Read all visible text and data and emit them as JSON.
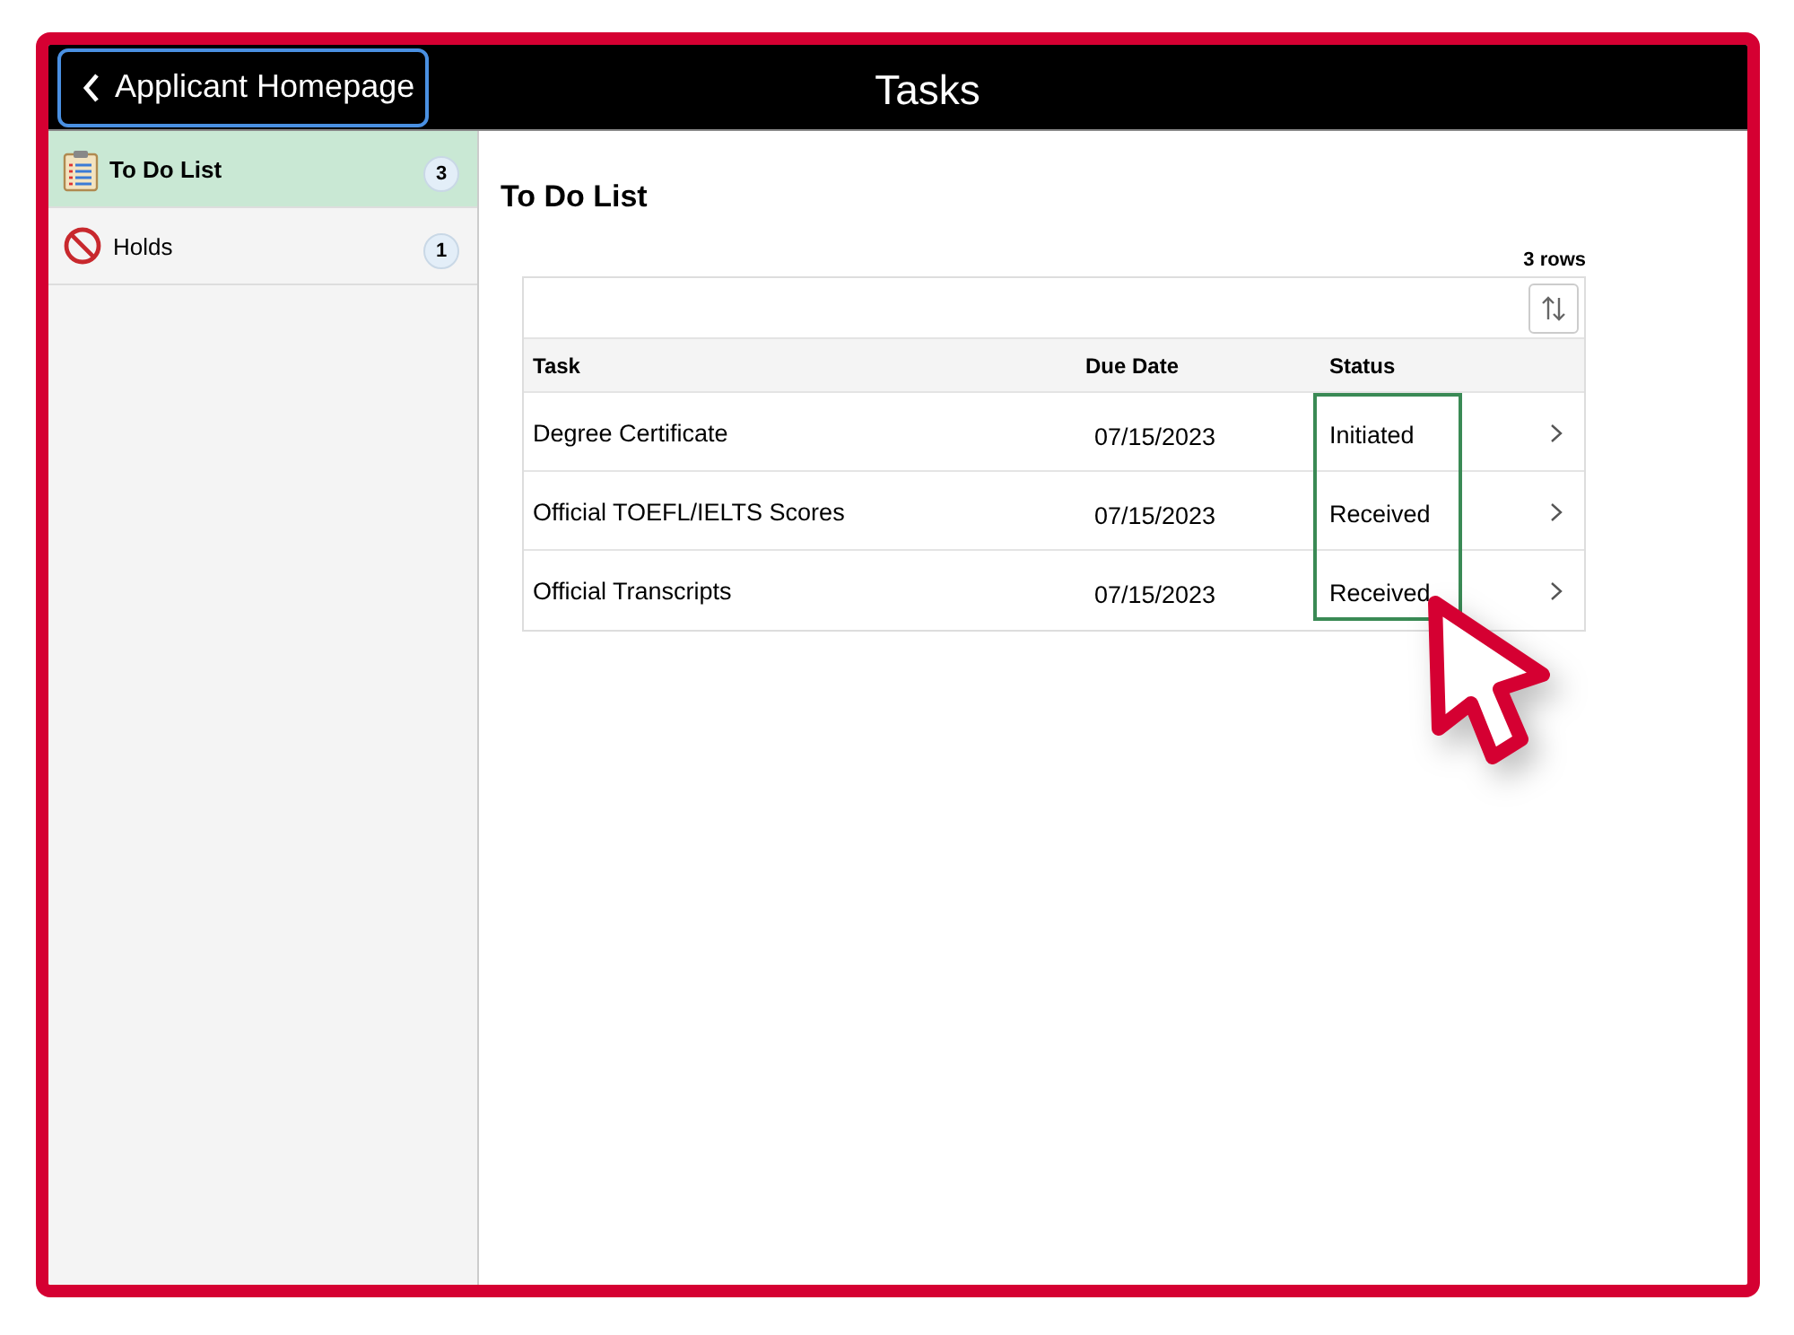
{
  "header": {
    "back_button": "Applicant Homepage",
    "title": "Tasks"
  },
  "sidebar": {
    "items": [
      {
        "kind": "todo",
        "label": "To Do List",
        "count": "3",
        "selected": true
      },
      {
        "kind": "holds",
        "label": "Holds",
        "count": "1",
        "selected": false
      }
    ]
  },
  "content": {
    "title": "To Do List",
    "row_count": "3 rows",
    "table": {
      "columns": [
        "Task",
        "Due Date",
        "Status"
      ],
      "rows": [
        {
          "task": "Degree Certificate",
          "due_date": "07/15/2023",
          "status": "Initiated"
        },
        {
          "task": "Official TOEFL/IELTS Scores",
          "due_date": "07/15/2023",
          "status": "Received"
        },
        {
          "task": "Official Transcripts",
          "due_date": "07/15/2023",
          "status": "Received"
        }
      ]
    }
  }
}
